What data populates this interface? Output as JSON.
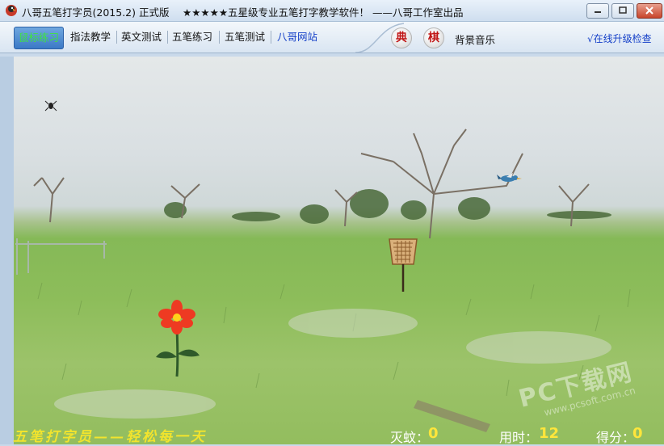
{
  "window": {
    "title": "八哥五笔打字员(2015.2) 正式版",
    "slogan": "★★★★★五星级专业五笔打字教学软件！ ——八哥工作室出品"
  },
  "toolbar": {
    "tabs": [
      {
        "label": "鼠标练习"
      },
      {
        "label": "指法教学"
      },
      {
        "label": "英文测试"
      },
      {
        "label": "五笔练习"
      },
      {
        "label": "五笔测试"
      },
      {
        "label": "八哥网站"
      }
    ],
    "dict_button": "典",
    "chess_button": "棋",
    "bg_music": "背景音乐",
    "upgrade": "√在线升级检查"
  },
  "hud": {
    "slogan": "五笔打字员——轻松每一天",
    "kills_label": "灭蚊：",
    "kills_value": "0",
    "time_label": "用时：",
    "time_value": "12",
    "score_label": "得分：",
    "score_value": "0"
  },
  "watermark": {
    "text": "PC下载网",
    "url": "www.pcsoft.com.cn"
  }
}
